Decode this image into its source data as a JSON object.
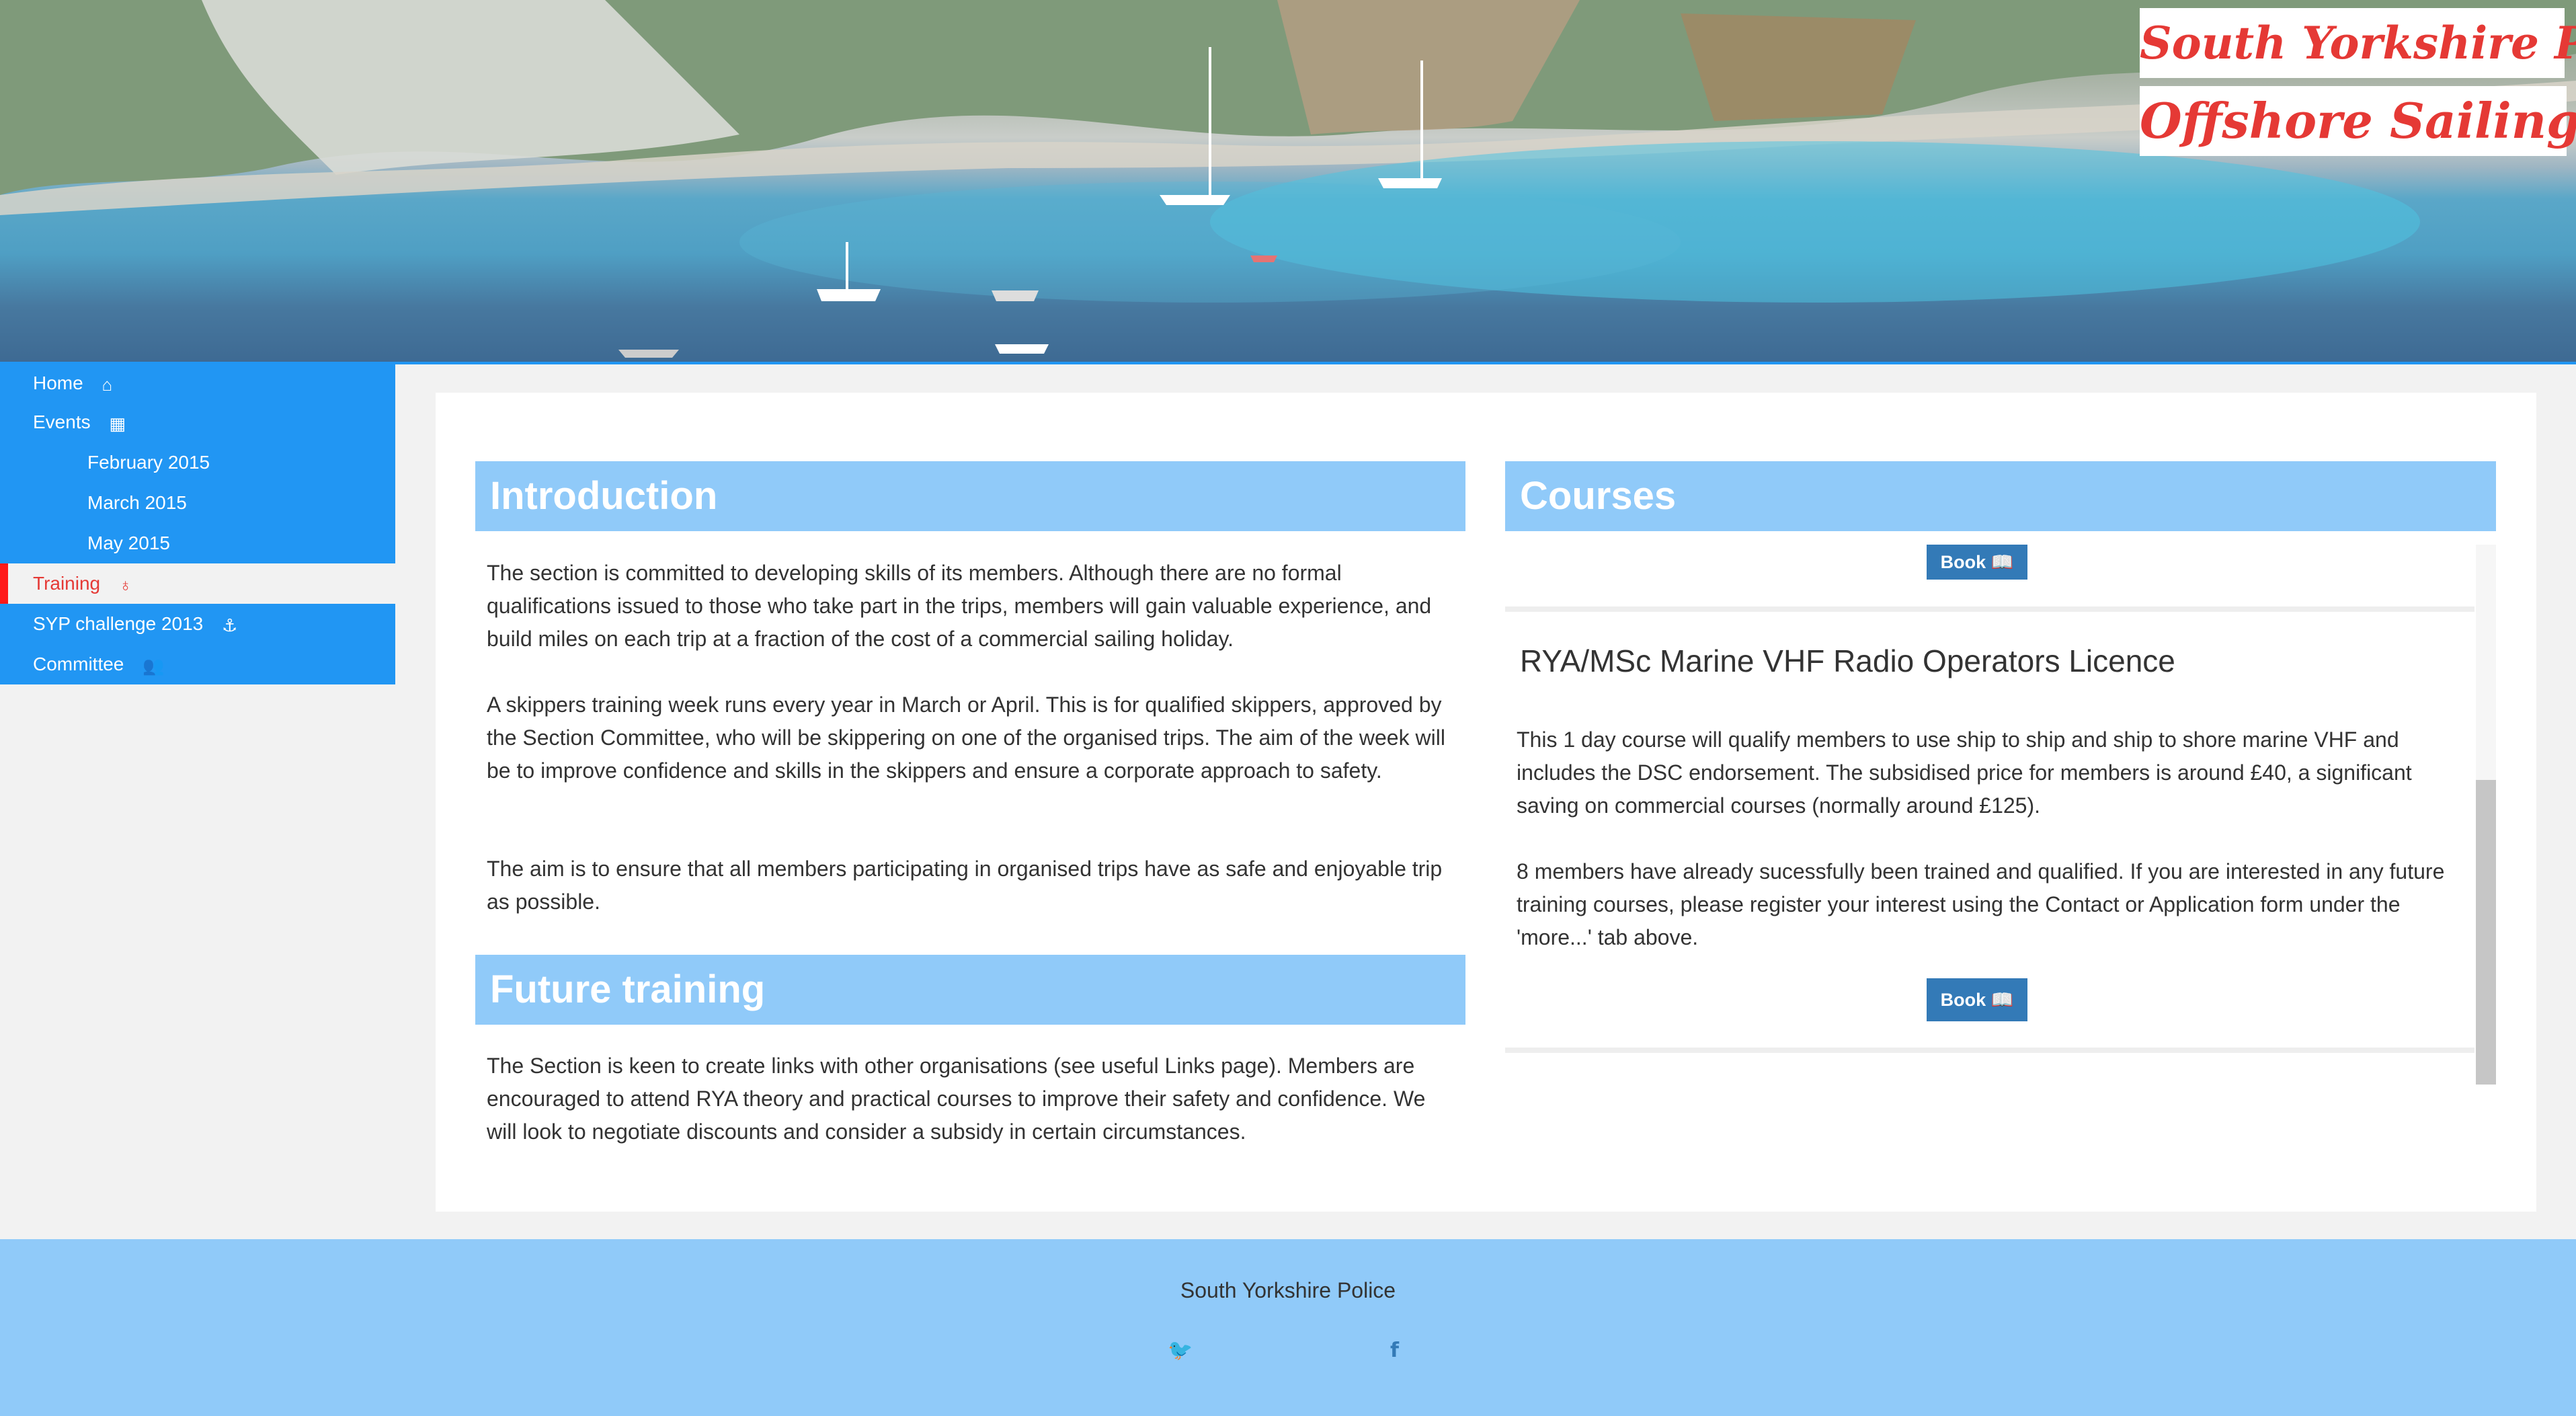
{
  "header": {
    "title_line1": "South Yorkshire Police",
    "title_line2": "Offshore Sailing"
  },
  "sidebar": {
    "items": [
      {
        "label": "Home",
        "icon": "home-icon",
        "glyph": "⌂"
      },
      {
        "label": "Events",
        "icon": "calendar-icon",
        "glyph": "▦"
      },
      {
        "label": "February 2015"
      },
      {
        "label": "March 2015"
      },
      {
        "label": "May 2015"
      },
      {
        "label": "Training",
        "icon": "lightbulb-icon",
        "glyph": "♁"
      },
      {
        "label": "SYP challenge 2013",
        "icon": "anchor-icon",
        "glyph": "⚓"
      },
      {
        "label": "Committee",
        "icon": "users-icon",
        "glyph": "👥"
      }
    ],
    "active": "Training"
  },
  "introduction": {
    "heading": "Introduction",
    "paragraphs": [
      "The section is committed to developing skills of its members. Although there are no formal qualifications issued to those who take part in the trips, members will gain valuable experience, and build miles on each trip at a fraction of the cost of a commercial sailing holiday.",
      "A skippers training week runs every year in March or April. This is for qualified skippers, approved by the Section Committee, who will be skippering on one of the organised trips. The aim of the week will be to improve confidence and skills in the skippers and ensure a corporate approach to safety.",
      "The aim is to ensure that all members participating in organised trips have as safe and enjoyable trip as possible."
    ]
  },
  "future_training": {
    "heading": "Future training",
    "paragraph": "The Section is keen to create links with other organisations (see useful Links page). Members are encouraged to attend RYA theory and practical courses to improve their safety and confidence. We will look to negotiate discounts and consider a subsidy in certain circumstances."
  },
  "courses": {
    "heading": "Courses",
    "book_label": "Book",
    "book_icon": "book-icon",
    "course_title": "RYA/MSc Marine VHF Radio Operators Licence",
    "paragraphs": [
      "This 1 day course will qualify members to use ship to ship and ship to shore marine VHF and includes the DSC endorsement. The subsidised price for members is around £40, a significant saving on commercial courses (normally around £125).",
      "8 members have already sucessfully been trained and qualified. If you are interested in any future training courses, please register your interest using the Contact or Application form under the 'more...' tab above."
    ]
  },
  "footer": {
    "text": "South Yorkshire Police",
    "social": [
      {
        "icon": "twitter-icon",
        "glyph": "🐦"
      },
      {
        "icon": "facebook-icon",
        "glyph": "f"
      }
    ]
  },
  "colors": {
    "primary": "#2196f3",
    "light_blue": "#90caf9",
    "active_red": "#e53935",
    "button_blue": "#337ab7"
  }
}
